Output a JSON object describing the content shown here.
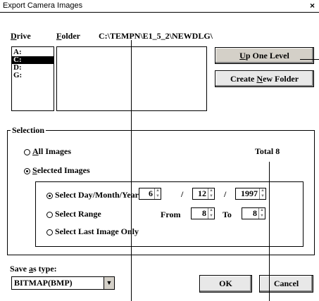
{
  "window": {
    "title": "Export Camera Images",
    "close_glyph": "×"
  },
  "drive": {
    "label_accel": "D",
    "label_rest": "rive",
    "items": [
      "A:",
      "C:",
      "D:",
      "G:"
    ],
    "selected_index": 1
  },
  "folder": {
    "label_accel": "F",
    "label_rest": "older",
    "path": "C:\\TEMPN\\E1_5_2\\NEWDLG\\"
  },
  "buttons": {
    "up_accel": "U",
    "up_rest": "p One Level",
    "create_pre": "Create ",
    "create_accel": "N",
    "create_rest": "ew Folder",
    "ok": "OK",
    "cancel": "Cancel"
  },
  "selection": {
    "legend": "Selection",
    "all_accel": "A",
    "all_rest": "ll Images",
    "selected_accel": "S",
    "selected_rest": "elected Images",
    "total": "Total 8",
    "mode": "selected"
  },
  "options": {
    "day_label": "Select Day/Month/Year",
    "range_label": "Select Range",
    "last_label": "Select Last Image Only",
    "active": "day",
    "day": "6",
    "month": "12",
    "year": "1997",
    "sep1": "/",
    "sep2": "/",
    "from_label": "From",
    "from_value": "8",
    "to_label": "To",
    "to_value": "8"
  },
  "save_type": {
    "label_pre": "Save ",
    "label_accel": "a",
    "label_rest": "s type:",
    "value": "BITMAP(BMP)"
  },
  "icons": {
    "close": "close-icon",
    "spin_up": "spin-up-arrow-icon",
    "spin_down": "spin-down-arrow-icon",
    "dropdown": "chevron-down-icon"
  }
}
